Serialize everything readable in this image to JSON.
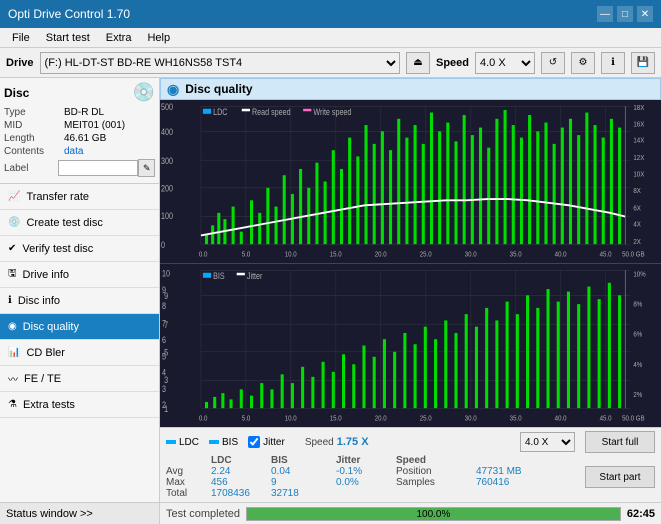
{
  "app": {
    "title": "Opti Drive Control 1.70",
    "titlebar_controls": [
      "—",
      "□",
      "✕"
    ]
  },
  "menubar": {
    "items": [
      "File",
      "Start test",
      "Extra",
      "Help"
    ]
  },
  "drivebar": {
    "label": "Drive",
    "drive_value": "(F:)  HL-DT-ST BD-RE  WH16NS58 TST4",
    "speed_label": "Speed",
    "speed_value": "4.0 X"
  },
  "disc": {
    "title": "Disc",
    "type_label": "Type",
    "type_value": "BD-R DL",
    "mid_label": "MID",
    "mid_value": "MEIT01 (001)",
    "length_label": "Length",
    "length_value": "46.61 GB",
    "contents_label": "Contents",
    "contents_value": "data",
    "label_label": "Label",
    "label_value": ""
  },
  "nav": {
    "items": [
      {
        "id": "transfer-rate",
        "label": "Transfer rate",
        "active": false
      },
      {
        "id": "create-test-disc",
        "label": "Create test disc",
        "active": false
      },
      {
        "id": "verify-test-disc",
        "label": "Verify test disc",
        "active": false
      },
      {
        "id": "drive-info",
        "label": "Drive info",
        "active": false
      },
      {
        "id": "disc-info",
        "label": "Disc info",
        "active": false
      },
      {
        "id": "disc-quality",
        "label": "Disc quality",
        "active": true
      },
      {
        "id": "cd-bler",
        "label": "CD Bler",
        "active": false
      },
      {
        "id": "fe-te",
        "label": "FE / TE",
        "active": false
      },
      {
        "id": "extra-tests",
        "label": "Extra tests",
        "active": false
      }
    ]
  },
  "status_window": {
    "label": "Status window >>"
  },
  "disc_quality": {
    "title": "Disc quality"
  },
  "chart1": {
    "legend": {
      "ldc": "LDC",
      "read_speed": "Read speed",
      "write_speed": "Write speed"
    },
    "y_max": 500,
    "y_right_labels": [
      "18X",
      "16X",
      "14X",
      "12X",
      "10X",
      "8X",
      "6X",
      "4X",
      "2X"
    ],
    "x_labels": [
      "0.0",
      "5.0",
      "10.0",
      "15.0",
      "20.0",
      "25.0",
      "30.0",
      "35.0",
      "40.0",
      "45.0",
      "50.0 GB"
    ]
  },
  "chart2": {
    "legend": {
      "bis": "BIS",
      "jitter": "Jitter"
    },
    "y_max": 10,
    "y_right_labels": [
      "10%",
      "8%",
      "6%",
      "4%",
      "2%"
    ],
    "x_labels": [
      "0.0",
      "5.0",
      "10.0",
      "15.0",
      "20.0",
      "25.0",
      "30.0",
      "35.0",
      "40.0",
      "45.0",
      "50.0 GB"
    ]
  },
  "stats": {
    "col_headers": [
      "",
      "LDC",
      "BIS",
      "",
      "Jitter",
      "Speed",
      ""
    ],
    "rows": [
      {
        "label": "Avg",
        "ldc": "2.24",
        "bis": "0.04",
        "jitter": "-0.1%",
        "speed_label": "Position",
        "speed_value": "1.75 X",
        "right_value": "47731 MB"
      },
      {
        "label": "Max",
        "ldc": "456",
        "bis": "9",
        "jitter": "0.0%",
        "speed_label": "Samples",
        "speed_value": "",
        "right_value": "760416"
      },
      {
        "label": "Total",
        "ldc": "1708436",
        "bis": "32718",
        "jitter": "",
        "speed_label": "",
        "speed_value": "",
        "right_value": ""
      }
    ],
    "jitter_checked": true,
    "speed_display": "1.75 X",
    "speed_select": "4.0 X",
    "position_label": "Position",
    "position_value": "47731 MB",
    "samples_label": "Samples",
    "samples_value": "760416"
  },
  "buttons": {
    "start_full": "Start full",
    "start_part": "Start part"
  },
  "statusbar": {
    "status_text": "Test completed",
    "progress_percent": "100.0%",
    "time": "62:45"
  }
}
